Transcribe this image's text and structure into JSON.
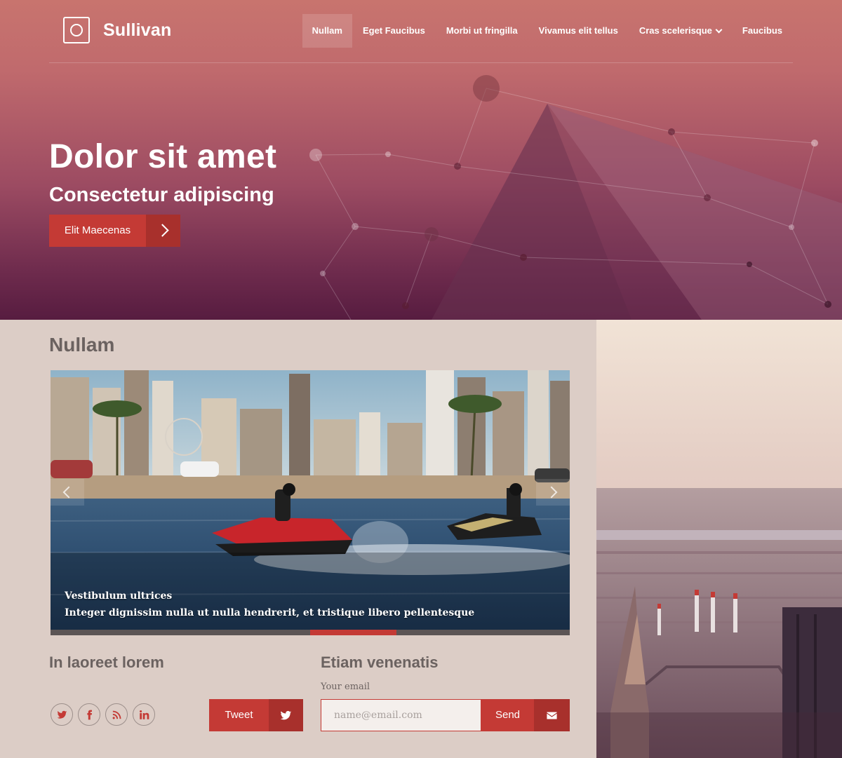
{
  "brand": {
    "name": "Sullivan",
    "logo_icon": "circle-in-square-icon"
  },
  "nav": {
    "items": [
      {
        "label": "Nullam",
        "active": true
      },
      {
        "label": "Eget Faucibus"
      },
      {
        "label": "Morbi ut fringilla"
      },
      {
        "label": "Vivamus elit tellus"
      },
      {
        "label": "Cras scelerisque",
        "dropdown": true
      },
      {
        "label": "Faucibus"
      }
    ]
  },
  "hero": {
    "title": "Dolor sit amet",
    "subtitle": "Consectetur adipiscing",
    "button_label": "Elit Maecenas",
    "button_icon": "chevron-right-icon"
  },
  "main": {
    "section_title": "Nullam",
    "slider": {
      "caption_title": "Vestibulum ultrices",
      "caption_text": "Integer dignissim nulla ut nulla hendrerit, et tristique libero pellentesque",
      "active_slide": 4,
      "slide_count": 6
    }
  },
  "social": {
    "title": "In laoreet lorem",
    "icons": [
      "twitter-icon",
      "facebook-icon",
      "rss-icon",
      "linkedin-icon"
    ],
    "tweet_label": "Tweet"
  },
  "newsletter": {
    "title": "Etiam venenatis",
    "email_label": "Your email",
    "email_placeholder": "name@email.com",
    "email_value": "",
    "send_label": "Send",
    "send_icon": "envelope-icon"
  },
  "colors": {
    "accent": "#c43a35",
    "accent_dark": "#a8302c",
    "panel_bg": "#dccdc6",
    "heading": "#6b6260"
  }
}
